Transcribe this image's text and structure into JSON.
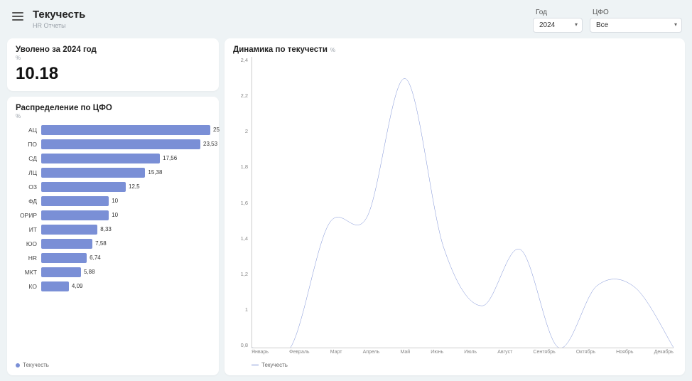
{
  "header": {
    "title": "Текучесть",
    "subtitle": "HR Отчеты",
    "filters": {
      "year": {
        "label": "Год",
        "value": "2024"
      },
      "cfo": {
        "label": "ЦФО",
        "value": "Все"
      }
    }
  },
  "kpi": {
    "title": "Уволено за 2024 год",
    "unit": "%",
    "value": "10.18"
  },
  "distribution": {
    "title": "Распределение по ЦФО",
    "unit": "%",
    "legend": "Текучесть"
  },
  "dynamics": {
    "title": "Динамика по текучести",
    "unit": "%",
    "legend": "Текучесть"
  },
  "chart_data": [
    {
      "id": "distribution",
      "type": "bar",
      "orientation": "horizontal",
      "title": "Распределение по ЦФО",
      "xlabel": "",
      "ylabel": "",
      "xlim": [
        0,
        25
      ],
      "categories": [
        "АЦ",
        "ПО",
        "СД",
        "ЛЦ",
        "ОЗ",
        "ФД",
        "ОРИР",
        "ИТ",
        "ЮО",
        "HR",
        "МКТ",
        "КО"
      ],
      "values": [
        25,
        23.53,
        17.56,
        15.38,
        12.5,
        10,
        10,
        8.33,
        7.58,
        6.74,
        5.88,
        4.09
      ],
      "series_name": "Текучесть",
      "color": "#7a8fd6"
    },
    {
      "id": "dynamics",
      "type": "line",
      "title": "Динамика по текучести",
      "xlabel": "",
      "ylabel": "",
      "ylim": [
        0,
        2.4
      ],
      "yticks": [
        0.8,
        1,
        1.2,
        1.4,
        1.6,
        1.8,
        2,
        2.2,
        2.4
      ],
      "categories": [
        "Январь",
        "Февраль",
        "Март",
        "Апрель",
        "Май",
        "Июнь",
        "Июль",
        "Август",
        "Сентябрь",
        "Октябрь",
        "Ноябрь",
        "Декабрь"
      ],
      "series": [
        {
          "name": "Текучесть",
          "values": [
            0.77,
            0.78,
            1.48,
            1.52,
            2.28,
            1.35,
            1.03,
            1.34,
            0.68,
            1.14,
            1.13,
            0.03
          ]
        }
      ],
      "color": "#7a8fd6"
    }
  ]
}
